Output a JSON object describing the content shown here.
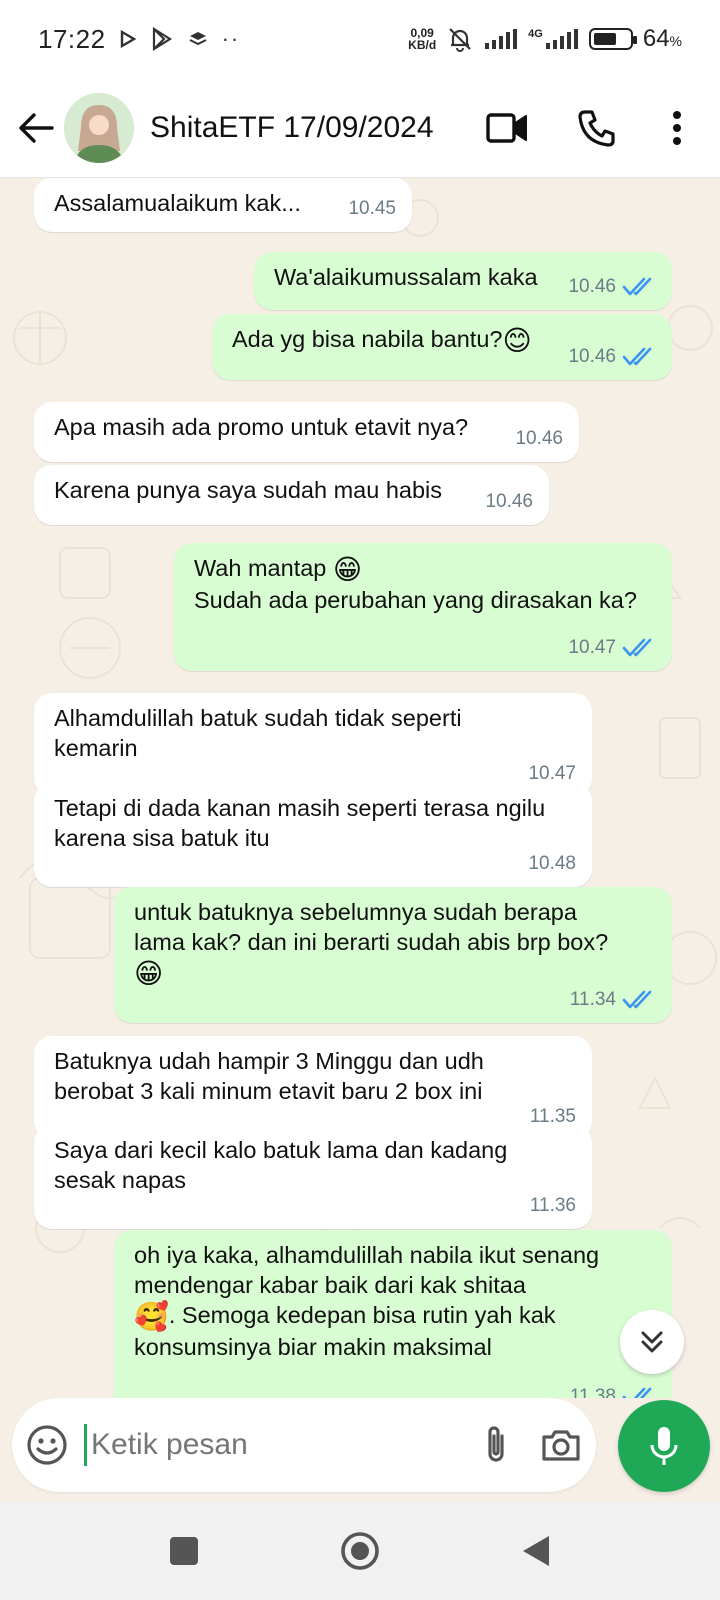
{
  "status_bar": {
    "time": "17:22",
    "speed_value": "0,09",
    "speed_unit": "KB/d",
    "network": "4G",
    "battery_pct": "64",
    "battery_unit": "%",
    "battery_level": 0.64
  },
  "header": {
    "title": "ShitaETF 17/09/2024"
  },
  "messages": [
    {
      "dir": "in",
      "text": "Assalamualaikum kak...",
      "time": "10.45"
    },
    {
      "dir": "out",
      "text": "Wa'alaikumussalam kaka",
      "time": "10.46"
    },
    {
      "dir": "out",
      "text": "Ada yg bisa nabila bantu?",
      "emoji": "😊",
      "time": "10.46"
    },
    {
      "dir": "in",
      "text": "Apa masih ada promo untuk etavit nya?",
      "time": "10.46"
    },
    {
      "dir": "in",
      "text": "Karena punya saya sudah mau habis",
      "time": "10.46"
    },
    {
      "dir": "out",
      "text_line1": "Wah mantap",
      "emoji": "😁",
      "text_line2": "Sudah ada perubahan yang dirasakan ka?",
      "time": "10.47"
    },
    {
      "dir": "in",
      "text": "Alhamdulillah batuk sudah tidak seperti\nkemarin",
      "time": "10.47"
    },
    {
      "dir": "in",
      "text": "Tetapi di dada kanan masih seperti terasa ngilu\nkarena sisa batuk itu",
      "time": "10.48"
    },
    {
      "dir": "out",
      "text": "untuk batuknya sebelumnya sudah berapa\nlama kak? dan ini berarti sudah abis brp box?",
      "emoji": "😁",
      "time": "11.34"
    },
    {
      "dir": "in",
      "text": "Batuknya udah hampir 3 Minggu dan udh\nberobat 3 kali minum etavit baru 2 box ini",
      "time": "11.35"
    },
    {
      "dir": "in",
      "text": "Saya dari kecil kalo batuk lama dan kadang\nsesak napas",
      "time": "11.36"
    },
    {
      "dir": "out",
      "text_line1": "oh iya kaka, alhamdulillah nabila ikut senang\nmendengar kabar baik dari kak shitaa",
      "emoji": "🥰",
      "text_line2": ". Semoga kedepan bisa rutin yah kak\nkonsumsinya biar makin maksimal",
      "time": "11.38"
    }
  ],
  "input": {
    "placeholder": "Ketik pesan"
  },
  "colors": {
    "outgoing_bubble": "#d9fdd3",
    "incoming_bubble": "#ffffff",
    "read_ticks": "#3b95f0",
    "mic_button": "#1fa855",
    "chat_bg": "#f5efe6"
  },
  "icons": {
    "back": "arrow-left-icon",
    "video": "video-camera-icon",
    "call": "phone-icon",
    "menu": "more-vertical-icon",
    "emoji": "emoji-icon",
    "attach": "paperclip-icon",
    "camera": "camera-icon",
    "mic": "microphone-icon",
    "scroll": "double-chevron-down-icon"
  }
}
